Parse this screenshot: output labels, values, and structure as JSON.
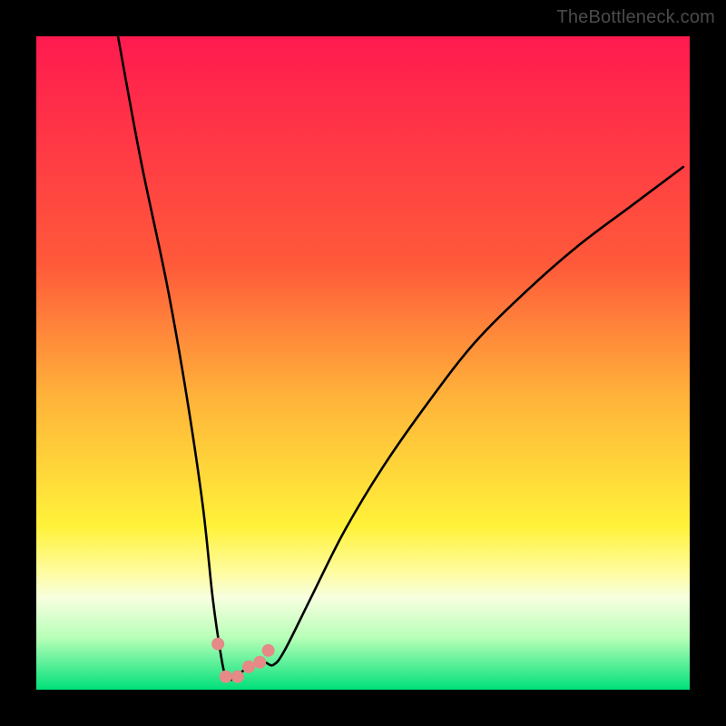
{
  "attribution": "TheBottleneck.com",
  "chart_data": {
    "type": "line",
    "title": "",
    "xlabel": "",
    "ylabel": "",
    "xlim": [
      0,
      100
    ],
    "ylim": [
      0,
      100
    ],
    "gradient_stops": [
      {
        "offset": 0,
        "color": "#ff1a4f"
      },
      {
        "offset": 35,
        "color": "#ff5a3a"
      },
      {
        "offset": 55,
        "color": "#ffb23a"
      },
      {
        "offset": 75,
        "color": "#fff23a"
      },
      {
        "offset": 82,
        "color": "#fffca0"
      },
      {
        "offset": 86,
        "color": "#f7ffe0"
      },
      {
        "offset": 92,
        "color": "#b8ffb8"
      },
      {
        "offset": 100,
        "color": "#00e07a"
      }
    ],
    "series": [
      {
        "name": "bottleneck-curve",
        "x": [
          12.5,
          16,
          20,
          23,
          25.5,
          27,
          28.3,
          29,
          29.7,
          30.5,
          32.5,
          34,
          35,
          36.3,
          38,
          42,
          47,
          53,
          60,
          67,
          75,
          83,
          91,
          99
        ],
        "y": [
          100,
          81,
          62,
          45,
          28,
          14,
          5,
          2,
          1.5,
          2,
          3.5,
          4.2,
          4.2,
          3.8,
          6,
          14,
          24,
          34,
          44,
          53,
          61,
          68,
          74,
          80
        ]
      }
    ],
    "markers": {
      "name": "valley-points",
      "color": "#e58a86",
      "radius": 7,
      "points": [
        {
          "x": 27.8,
          "y": 7
        },
        {
          "x": 29.0,
          "y": 2
        },
        {
          "x": 30.8,
          "y": 2
        },
        {
          "x": 32.5,
          "y": 3.5
        },
        {
          "x": 34.2,
          "y": 4.2
        },
        {
          "x": 35.5,
          "y": 6
        }
      ]
    }
  }
}
